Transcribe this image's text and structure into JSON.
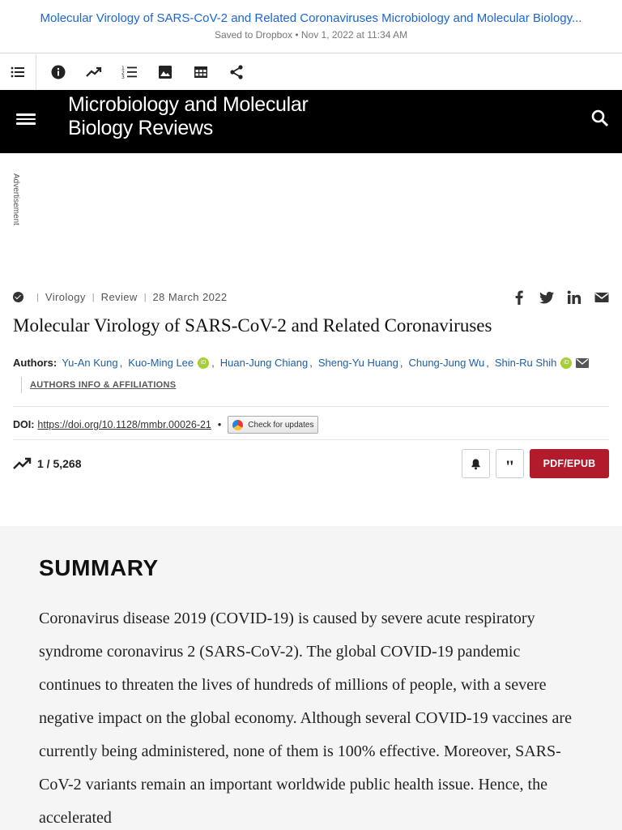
{
  "dropbox": {
    "title": "Molecular Virology of SARS-CoV-2 and Related Coronaviruses  Microbiology and Molecular Biology...",
    "subtitle": "Saved to Dropbox • Nov 1, 2022 at 11:34 AM"
  },
  "toolbar": {
    "icons": [
      "list-icon",
      "info-icon",
      "trending-icon",
      "numbered-list-icon",
      "image-icon",
      "table-icon",
      "share-icon"
    ]
  },
  "journal": {
    "name_line1": "Microbiology and Molecular",
    "name_line2": "Biology Reviews"
  },
  "advertisement": "Advertisement",
  "article": {
    "category": "Virology",
    "type": "Review",
    "date": "28 March 2022",
    "title": "Molecular Virology of SARS-CoV-2 and Related Coronaviruses",
    "authors_label": "Authors",
    "authors": [
      "Yu-An Kung",
      "Kuo-Ming Lee",
      "Huan-Jung Chiang",
      "Sheng-Yu Huang",
      "Chung-Jung Wu",
      "Shin-Ru Shih"
    ],
    "affiliations_link": "AUTHORS INFO & AFFILIATIONS",
    "doi_label": "DOI:",
    "doi": "https://doi.org/10.1128/mmbr.00026-21",
    "check_updates": "Check for updates",
    "metrics": "1 / 5,268",
    "pdf_button": "PDF/EPUB"
  },
  "share": [
    "facebook-icon",
    "twitter-icon",
    "linkedin-icon",
    "email-icon"
  ],
  "summary": {
    "heading": "SUMMARY",
    "text": "Coronavirus disease 2019 (COVID-19) is caused by severe acute respiratory syndrome coronavirus 2 (SARS-CoV-2). The global COVID-19 pandemic continues to threaten the lives of hundreds of millions of people, with a severe negative impact on the global economy. Although several COVID-19 vaccines are currently being administered, none of them is 100% effective. Moreover, SARS-CoV-2 variants remain an important worldwide public health issue. Hence, the accelerated"
  },
  "colors": {
    "link": "#1f5fa6",
    "dropbox_link": "#1a66d6",
    "pdf_button": "#b11b2b",
    "header_bg": "#000000",
    "orcid": "#a6ce39"
  }
}
